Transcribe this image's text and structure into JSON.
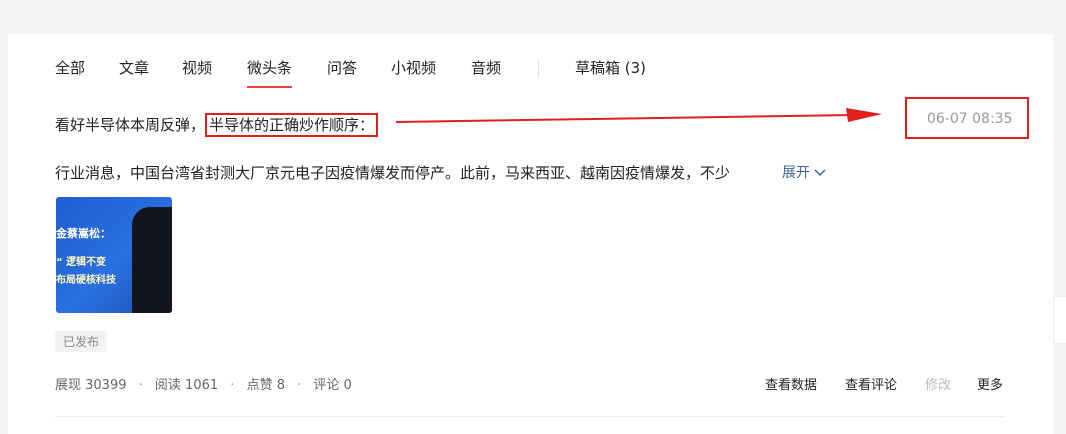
{
  "tabs": [
    {
      "label": "全部"
    },
    {
      "label": "文章"
    },
    {
      "label": "视频"
    },
    {
      "label": "微头条",
      "active": true
    },
    {
      "label": "问答"
    },
    {
      "label": "小视频"
    },
    {
      "label": "音频"
    },
    {
      "label": "草稿箱 (3)"
    }
  ],
  "post": {
    "headline_part1": "看好半导体本周反弹，",
    "headline_part2": "半导体的正确炒作顺序：",
    "date": "06-07 08:35",
    "content": "行业消息，中国台湾省封测大厂京元电子因疫情爆发而停产。此前，马来西亚、越南因疫情爆发，不少",
    "expand_label": "展开",
    "thumbnail": {
      "line1": "金蔡嵩松：",
      "line2": "“ 逻辑不变",
      "line3": "布局硬核科技"
    },
    "status_badge": "已发布"
  },
  "stats": {
    "impressions": "展现 30399",
    "reads": "阅读 1061",
    "likes": "点赞 8",
    "comments": "评论 0",
    "separator": "·"
  },
  "actions": {
    "view_data": "查看数据",
    "view_comments": "查看评论",
    "edit": "修改",
    "more": "更多"
  },
  "colors": {
    "annotation_red": "#e0201c",
    "active_tab_underline": "#f04142",
    "link_blue": "#406599"
  }
}
